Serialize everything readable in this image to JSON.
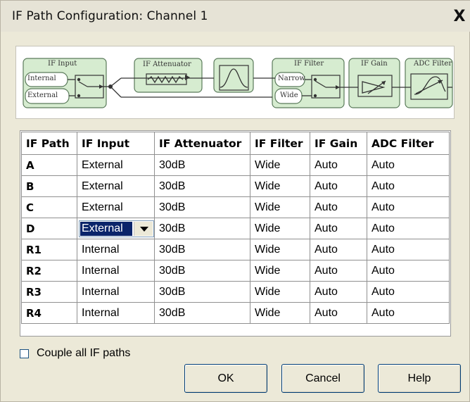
{
  "window": {
    "title": "IF Path Configuration: Channel 1",
    "close_label": "X"
  },
  "diagram": {
    "if_input_label": "IF Input",
    "internal_label": "Internal",
    "external_label": "External",
    "if_attenuator_label": "IF Attenuator",
    "if_filter_label": "IF Filter",
    "narrow_label": "Narrow",
    "wide_label": "Wide",
    "if_gain_label": "IF Gain",
    "adc_filter_label": "ADC Filter"
  },
  "table": {
    "headers": [
      "IF Path",
      "IF Input",
      "IF Attenuator",
      "IF Filter",
      "IF Gain",
      "ADC Filter"
    ],
    "rows": [
      {
        "path": "A",
        "input": "External",
        "attenuator": "30dB",
        "filter": "Wide",
        "gain": "Auto",
        "adc": "Auto"
      },
      {
        "path": "B",
        "input": "External",
        "attenuator": "30dB",
        "filter": "Wide",
        "gain": "Auto",
        "adc": "Auto"
      },
      {
        "path": "C",
        "input": "External",
        "attenuator": "30dB",
        "filter": "Wide",
        "gain": "Auto",
        "adc": "Auto"
      },
      {
        "path": "D",
        "input": "External",
        "attenuator": "30dB",
        "filter": "Wide",
        "gain": "Auto",
        "adc": "Auto"
      },
      {
        "path": "R1",
        "input": "Internal",
        "attenuator": "30dB",
        "filter": "Wide",
        "gain": "Auto",
        "adc": "Auto"
      },
      {
        "path": "R2",
        "input": "Internal",
        "attenuator": "30dB",
        "filter": "Wide",
        "gain": "Auto",
        "adc": "Auto"
      },
      {
        "path": "R3",
        "input": "Internal",
        "attenuator": "30dB",
        "filter": "Wide",
        "gain": "Auto",
        "adc": "Auto"
      },
      {
        "path": "R4",
        "input": "Internal",
        "attenuator": "30dB",
        "filter": "Wide",
        "gain": "Auto",
        "adc": "Auto"
      }
    ]
  },
  "couple": {
    "label": "Couple all IF paths",
    "checked": false
  },
  "buttons": {
    "ok": "OK",
    "cancel": "Cancel",
    "help": "Help"
  },
  "colors": {
    "selection": "#0a246a",
    "block_fill": "#d6ecd0",
    "block_border": "#5a7a5a"
  }
}
